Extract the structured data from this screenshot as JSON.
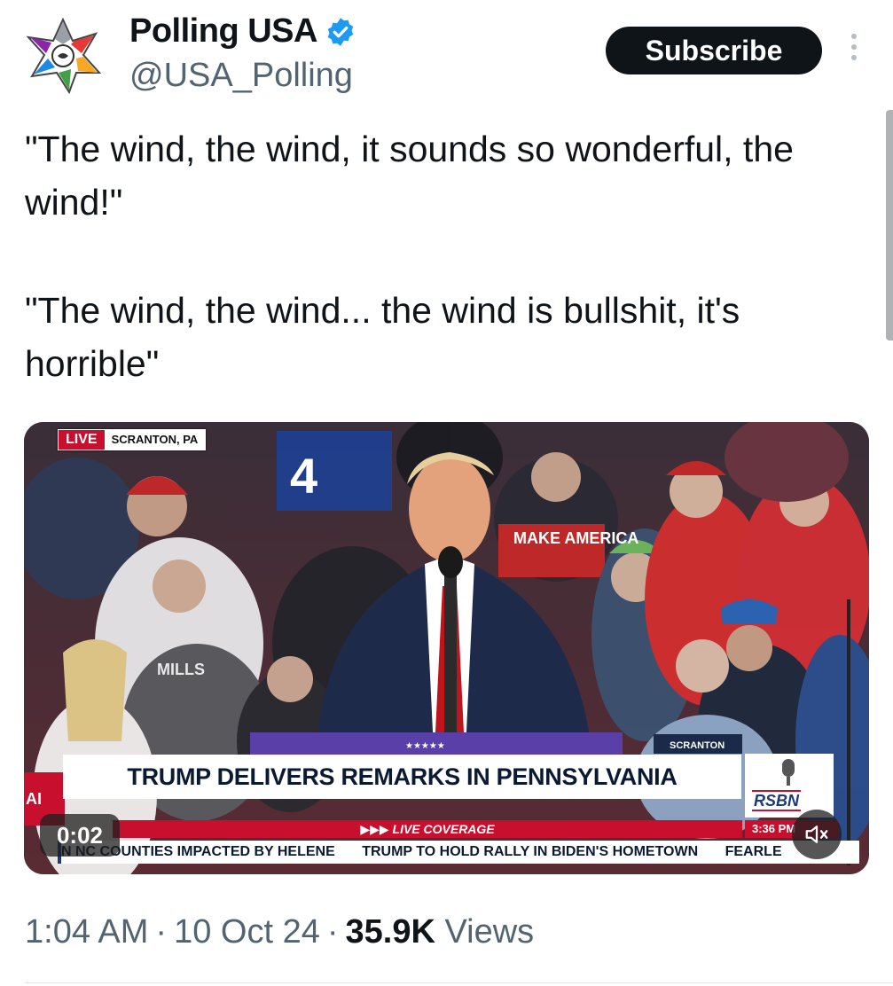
{
  "author": {
    "display_name": "Polling USA",
    "handle": "@USA_Polling",
    "verified_icon": "verified-badge-icon",
    "verified_color": "#1d9bf0"
  },
  "actions": {
    "subscribe_label": "Subscribe",
    "more_icon": "more-vertical-icon"
  },
  "tweet": {
    "paragraph_1": "\"The wind, the wind, it sounds so wonderful, the wind!\"",
    "paragraph_2": "\"The wind, the wind... the wind is bullshit, it's horrible\""
  },
  "video": {
    "live_label": "LIVE",
    "location": "SCRANTON, PA",
    "headline": "TRUMP DELIVERS REMARKS IN PENNSYLVANIA",
    "live_coverage": "▶▶▶ LIVE COVERAGE",
    "network": "RSBN",
    "clock": "3:36 PM",
    "left_stub": "AI",
    "ticker": [
      "N NC COUNTIES IMPACTED BY HELENE",
      "TRUMP TO HOLD RALLY IN BIDEN'S HOMETOWN",
      "FEARLE"
    ],
    "sign_make_america": "MAKE AMERICA",
    "sign_number": "4",
    "shirt_text": "MILLS",
    "podium_sign": "SCRANTON",
    "elapsed": "0:02",
    "mute_icon": "speaker-muted-icon"
  },
  "meta": {
    "time": "1:04 AM",
    "date": "10 Oct 24",
    "separator": "·",
    "views_count": "35.9K",
    "views_label": "Views"
  }
}
